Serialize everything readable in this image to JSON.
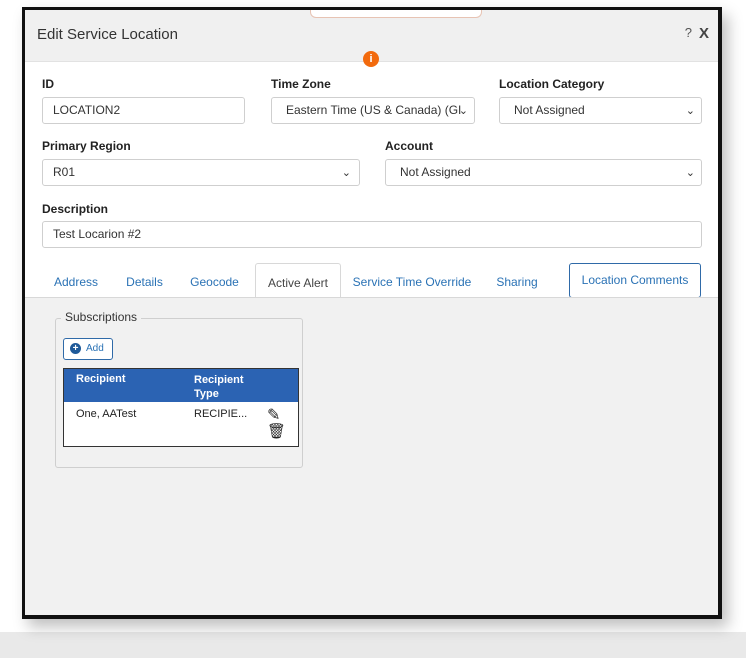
{
  "dialog": {
    "title": "Edit Service Location",
    "help_label": "?",
    "close_label": "X",
    "info_label": "i"
  },
  "form": {
    "id_label": "ID",
    "id_value": "LOCATION2",
    "timezone_label": "Time Zone",
    "timezone_value": "Eastern Time (US & Canada) (GI",
    "location_category_label": "Location Category",
    "location_category_value": "Not Assigned",
    "primary_region_label": "Primary Region",
    "primary_region_value": "R01",
    "account_label": "Account",
    "account_value": "Not Assigned",
    "description_label": "Description",
    "description_value": "Test Locarion #2"
  },
  "tabs": [
    {
      "label": "Address"
    },
    {
      "label": "Details"
    },
    {
      "label": "Geocode"
    },
    {
      "label": "Active Alert",
      "active": true
    },
    {
      "label": "Service Time Override"
    },
    {
      "label": "Sharing"
    },
    {
      "label": "Location Comments"
    }
  ],
  "subscriptions": {
    "legend": "Subscriptions",
    "add_label": "Add",
    "columns": [
      "Recipient",
      "Recipient Type"
    ],
    "rows": [
      {
        "recipient": "One, AATest",
        "type": "RECIPIE..."
      }
    ]
  },
  "icons": {
    "caret": "chevron-down-icon",
    "edit": "edit-icon",
    "delete": "trash-icon",
    "info": "info-icon",
    "add": "plus-circle-icon"
  },
  "colors": {
    "accent": "#2a72b5",
    "grid_header": "#2b63b3",
    "info": "#f26a0d"
  }
}
